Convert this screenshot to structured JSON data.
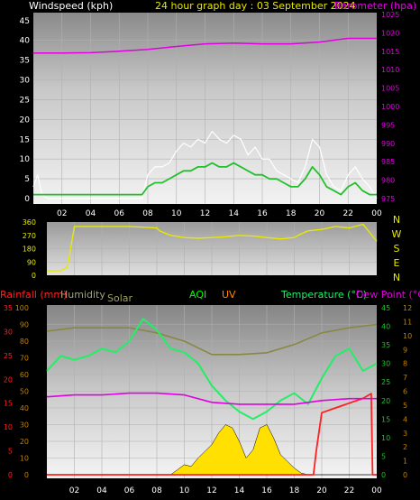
{
  "header": {
    "wind_label": "Windspeed (kph)",
    "title": "24 hour graph day : 03 September 2024",
    "baro_label": "Barometer (hpa)"
  },
  "colors": {
    "wind_gust": "#ffffff",
    "wind_avg": "#22c02a",
    "barometer": "#e000e0",
    "wind_dir": "#e8e800",
    "rain": "#ff2020",
    "humidity": "#888844",
    "solar": "#ffe000",
    "aqi": "#00ff00",
    "uv": "#ff8800",
    "temperature": "#22ee66",
    "dew_point": "#e000e0",
    "axis_orange": "#c08000",
    "axis_green": "#22c02a"
  },
  "legend": {
    "rainfall": "Rainfall (mm)",
    "humidity": "Humidity",
    "solar": "Solar",
    "aqi": "AQI",
    "uv": "UV",
    "temperature": "Temperature (°C)",
    "dew_point": "Dew Point (°C)"
  },
  "chart_data": [
    {
      "type": "line",
      "x_tick_labels": [
        "02",
        "04",
        "06",
        "08",
        "10",
        "12",
        "14",
        "16",
        "18",
        "20",
        "22",
        "00"
      ],
      "y_left_ticks": [
        "0",
        "5",
        "10",
        "15",
        "20",
        "25",
        "30",
        "35",
        "40",
        "45"
      ],
      "ylim_left": [
        0,
        47
      ],
      "y_right_ticks": [
        "975",
        "980",
        "985",
        "990",
        "995",
        "1000",
        "1005",
        "1010",
        "1015",
        "1020",
        "1025"
      ],
      "ylim_right": [
        973,
        1025
      ],
      "grid": true,
      "series": [
        {
          "key": "wind_gust",
          "hours": [
            0,
            0.3,
            0.6,
            1,
            3,
            5,
            7.6,
            8,
            8.5,
            9,
            9.5,
            10,
            10.5,
            11,
            11.5,
            12,
            12.5,
            13,
            13.5,
            14,
            14.5,
            15,
            15.5,
            16,
            16.5,
            17,
            17.5,
            18,
            18.5,
            19,
            19.5,
            20,
            20.5,
            21,
            21.5,
            22,
            22.5,
            23,
            23.5,
            24
          ],
          "values": [
            3,
            6,
            1,
            0,
            0,
            0,
            0,
            6,
            8,
            8,
            9,
            12,
            14,
            13,
            15,
            14,
            17,
            15,
            14,
            16,
            15,
            11,
            13,
            10,
            10,
            7,
            6,
            5,
            4,
            8,
            15,
            13,
            6,
            3,
            2,
            6,
            8,
            5,
            3,
            0
          ]
        },
        {
          "key": "wind_avg",
          "hours": [
            0,
            1,
            3,
            5,
            7.6,
            8,
            8.5,
            9,
            9.5,
            10,
            10.5,
            11,
            11.5,
            12,
            12.5,
            13,
            13.5,
            14,
            14.5,
            15,
            15.5,
            16,
            16.5,
            17,
            17.5,
            18,
            18.5,
            19,
            19.5,
            20,
            20.5,
            21,
            21.5,
            22,
            22.5,
            23,
            23.5,
            24
          ],
          "values": [
            1,
            1,
            1,
            1,
            1,
            3,
            4,
            4,
            5,
            6,
            7,
            7,
            8,
            8,
            9,
            8,
            8,
            9,
            8,
            7,
            6,
            6,
            5,
            5,
            4,
            3,
            3,
            5,
            8,
            6,
            3,
            2,
            1,
            3,
            4,
            2,
            1,
            1
          ]
        },
        {
          "key": "barometer",
          "hours": [
            0,
            2,
            4,
            6,
            8,
            10,
            12,
            14,
            16,
            18,
            20,
            22,
            24
          ],
          "values": [
            1014.5,
            1014.5,
            1014.6,
            1015,
            1015.5,
            1016.3,
            1017,
            1017.2,
            1017,
            1017,
            1017.5,
            1018.5,
            1018.5
          ]
        }
      ]
    },
    {
      "type": "line",
      "x_tick_labels": [
        "02",
        "04",
        "06",
        "08",
        "10",
        "12",
        "14",
        "16",
        "18",
        "20",
        "22",
        "00"
      ],
      "y_ticks": [
        "0",
        "90",
        "180",
        "270",
        "360"
      ],
      "ylim": [
        0,
        360
      ],
      "direction_labels": [
        "N",
        "W",
        "S",
        "E",
        "N"
      ],
      "series": [
        {
          "key": "wind_dir",
          "hours": [
            0,
            1,
            1.5,
            2,
            4,
            6,
            8,
            8.2,
            9,
            10,
            11,
            12,
            13,
            14,
            15,
            16,
            17,
            18,
            18.5,
            19,
            20,
            21,
            22,
            23,
            24
          ],
          "values": [
            30,
            30,
            55,
            330,
            330,
            330,
            320,
            300,
            270,
            255,
            250,
            255,
            260,
            270,
            265,
            255,
            245,
            255,
            280,
            300,
            310,
            330,
            320,
            345,
            230
          ]
        }
      ]
    },
    {
      "type": "line",
      "x_tick_labels": [
        "02",
        "04",
        "06",
        "08",
        "10",
        "12",
        "14",
        "16",
        "18",
        "20",
        "22",
        "00"
      ],
      "y_left_outer_ticks": [
        "0",
        "5",
        "10",
        "15",
        "20",
        "25",
        "30",
        "35"
      ],
      "ylim_left_outer": [
        0,
        35
      ],
      "y_left_inner_ticks": [
        "0",
        "10",
        "20",
        "30",
        "40",
        "50",
        "60",
        "70",
        "80",
        "90",
        "100"
      ],
      "ylim_left_inner": [
        0,
        100
      ],
      "y_right_inner_ticks": [
        "0",
        "5",
        "10",
        "15",
        "20",
        "25",
        "30",
        "35",
        "40",
        "45"
      ],
      "ylim_right_inner": [
        0,
        45
      ],
      "y_right_outer_ticks": [
        "0",
        "1",
        "2",
        "3",
        "4",
        "5",
        "6",
        "7",
        "8",
        "9",
        "10",
        "11",
        "12"
      ],
      "ylim_right_outer": [
        0,
        12
      ],
      "series": [
        {
          "key": "humidity",
          "hours": [
            0,
            2,
            4,
            6,
            8,
            10,
            12,
            14,
            16,
            18,
            20,
            22,
            24
          ],
          "values": [
            86,
            88,
            88,
            88,
            85,
            80,
            72,
            72,
            73,
            78,
            85,
            88,
            90
          ]
        },
        {
          "key": "solar",
          "hours": [
            0,
            9,
            9.5,
            10,
            10.5,
            11,
            11.5,
            12,
            12.5,
            13,
            13.5,
            14,
            14.5,
            15,
            15.5,
            16,
            16.5,
            17,
            17.5,
            18,
            18.5,
            19,
            24
          ],
          "values": [
            0,
            0,
            3,
            6,
            5,
            10,
            14,
            18,
            25,
            30,
            28,
            20,
            10,
            15,
            28,
            30,
            22,
            12,
            8,
            4,
            1,
            0,
            0
          ]
        },
        {
          "key": "rain",
          "hours": [
            0,
            19.4,
            19.6,
            20,
            21,
            22,
            23,
            23.6,
            23.7,
            24
          ],
          "values": [
            0,
            0,
            0.5,
            1.3,
            1.4,
            1.5,
            1.6,
            1.7,
            0,
            0
          ]
        },
        {
          "key": "temperature",
          "hours": [
            0,
            1,
            2,
            3,
            4,
            5,
            6,
            7,
            8,
            9,
            10,
            11,
            12,
            13,
            14,
            15,
            16,
            17,
            18,
            19,
            20,
            21,
            22,
            23,
            24
          ],
          "values": [
            28,
            32,
            31,
            32,
            34,
            33,
            36,
            42,
            39,
            34,
            33,
            30,
            24,
            20,
            17,
            15,
            17,
            20,
            22,
            19,
            26,
            32,
            34,
            28,
            30
          ]
        },
        {
          "key": "dew_point",
          "hours": [
            0,
            2,
            4,
            6,
            8,
            10,
            12,
            14,
            16,
            18,
            20,
            22,
            24
          ],
          "values": [
            21,
            21.5,
            21.5,
            22,
            22,
            21.5,
            19.5,
            19,
            19,
            19,
            20,
            20.5,
            20.5
          ]
        }
      ]
    }
  ]
}
